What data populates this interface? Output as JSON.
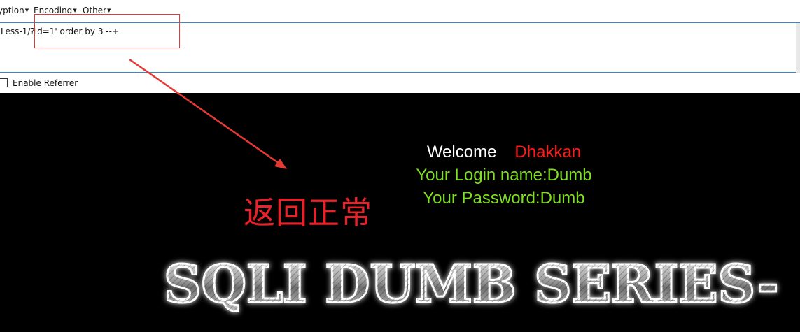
{
  "menu": {
    "encryption_label": "yption",
    "encoding_label": "Encoding",
    "other_label": "Other"
  },
  "url": {
    "value": "Less-1/?id=1' order by 3 --+"
  },
  "options": {
    "enable_referrer_label": "Enable Referrer"
  },
  "annotation": {
    "text": "返回正常"
  },
  "result": {
    "welcome": "Welcome",
    "welcome_name": "Dhakkan",
    "login": "Your Login name:Dumb",
    "password": "Your Password:Dumb"
  },
  "banner": {
    "text": "SQLI DUMB SERIES-"
  },
  "colors": {
    "annotation_red": "#e8222a",
    "login_green": "#7ee01f",
    "name_red": "#ff1a1a"
  }
}
